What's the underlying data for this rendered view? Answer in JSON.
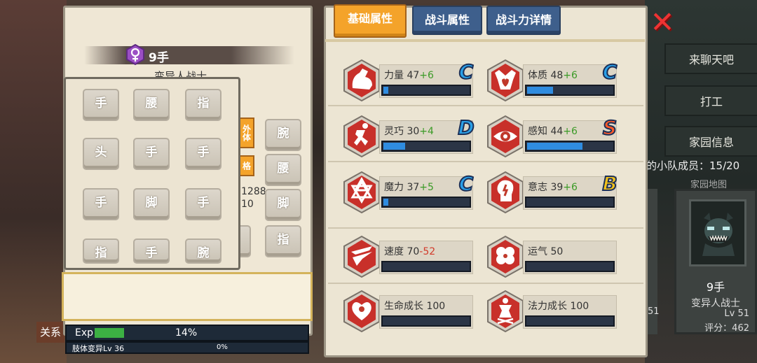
{
  "right_menu": {
    "chat": "来聊天吧",
    "work": "打工",
    "home_info": "家园信息",
    "team_members": "的小队成员：15/20",
    "homeland_map": "家园地图"
  },
  "member_card": {
    "name": "9手",
    "class": "变异人战士",
    "level": "Lv 51",
    "score": "评分：462",
    "partial_num": "51"
  },
  "character": {
    "name": "9手",
    "class": "变异人战士",
    "gender_icon": "female-icon"
  },
  "body_parts": {
    "grid": [
      "手",
      "腰",
      "指",
      "头",
      "手",
      "手",
      "手",
      "脚",
      "手",
      "指",
      "手",
      "腕"
    ],
    "side": [
      "腕",
      "腰",
      "脚",
      "指"
    ],
    "orange_tabs": [
      "外体",
      "格"
    ],
    "side_numbers": [
      "1288",
      "10"
    ]
  },
  "relation_tab": "关系",
  "exp": {
    "label": "Exp",
    "percent_text": "14%",
    "fill": 0.14,
    "sub_label": "肢体变异Lv 36",
    "sub_percent": "0%"
  },
  "tabs": [
    "基础属性",
    "战斗属性",
    "战斗力详情"
  ],
  "stats": [
    {
      "name": "力量",
      "value": "47",
      "bonus": "+6",
      "grade": "C",
      "grade_color": "#2aa0e8",
      "fill": 0.06,
      "icon": "muscle-arm-icon"
    },
    {
      "name": "体质",
      "value": "48",
      "bonus": "+6",
      "grade": "C",
      "grade_color": "#2aa0e8",
      "fill": 0.3,
      "icon": "body-heart-icon"
    },
    {
      "name": "灵巧",
      "value": "30",
      "bonus": "+4",
      "grade": "D",
      "grade_color": "#2aa0e8",
      "fill": 0.25,
      "icon": "runner-icon"
    },
    {
      "name": "感知",
      "value": "44",
      "bonus": "+6",
      "grade": "S",
      "grade_color": "#ff5a2a",
      "fill": 0.65,
      "icon": "eye-icon"
    },
    {
      "name": "魔力",
      "value": "37",
      "bonus": "+5",
      "grade": "C",
      "grade_color": "#2aa0e8",
      "fill": 0.06,
      "icon": "hexagram-icon"
    },
    {
      "name": "意志",
      "value": "39",
      "bonus": "+6",
      "grade": "B",
      "grade_color": "#f4c21a",
      "fill": 0.0,
      "icon": "mind-head-icon"
    },
    {
      "name": "速度",
      "value": "70",
      "bonus": "-52",
      "grade": "",
      "grade_color": "",
      "fill": 0.0,
      "icon": "speed-wing-icon"
    },
    {
      "name": "运气",
      "value": "50",
      "bonus": "",
      "grade": "",
      "grade_color": "",
      "fill": 0.0,
      "icon": "clover-icon"
    },
    {
      "name": "生命成长",
      "value": "100",
      "bonus": "",
      "grade": "",
      "grade_color": "",
      "fill": 0.0,
      "icon": "life-heart-icon"
    },
    {
      "name": "法力成长",
      "value": "100",
      "bonus": "",
      "grade": "",
      "grade_color": "",
      "fill": 0.0,
      "icon": "mana-figure-icon"
    }
  ],
  "close_label": "close"
}
